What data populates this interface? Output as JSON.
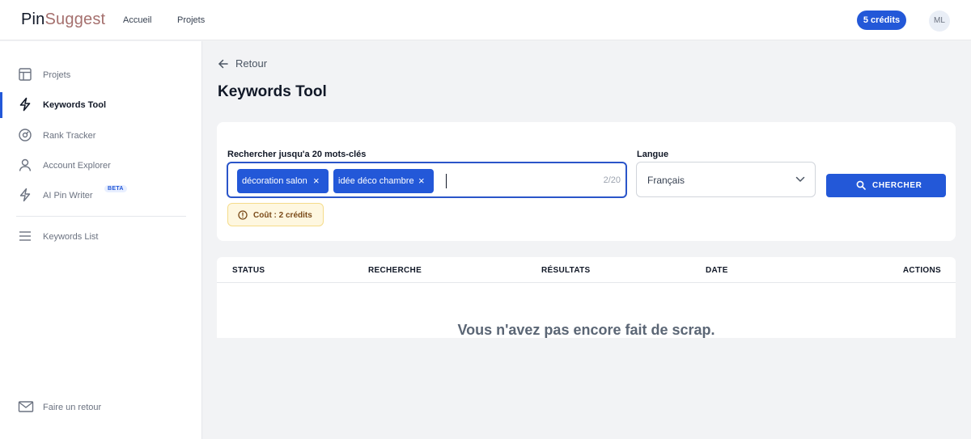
{
  "app": {
    "logo_part1": "Pin",
    "logo_part2": "Suggest"
  },
  "topnav": {
    "items": [
      {
        "label": "Accueil"
      },
      {
        "label": "Projets"
      }
    ],
    "credits_label": "5 crédits",
    "avatar_initials": "ML"
  },
  "sidebar": {
    "items": [
      {
        "label": "Projets",
        "icon": "layout-icon"
      },
      {
        "label": "Keywords Tool",
        "icon": "lightning-icon",
        "active": true
      },
      {
        "label": "Rank Tracker",
        "icon": "gauge-icon"
      },
      {
        "label": "Account Explorer",
        "icon": "user-icon"
      },
      {
        "label": "AI Pin Writer",
        "icon": "lightning-icon",
        "badge": "BETA"
      },
      {
        "label": "Keywords List",
        "icon": "menu-icon"
      }
    ],
    "feedback_label": "Faire un retour"
  },
  "main": {
    "back_label": "Retour",
    "title": "Keywords Tool"
  },
  "search_form": {
    "keywords_label": "Rechercher jusqu'a 20 mots-clés",
    "chips": [
      {
        "label": "décoration salon"
      },
      {
        "label": "idée déco chambre"
      }
    ],
    "input_value": "",
    "counter": "2/20",
    "language_label": "Langue",
    "language_value": "Français",
    "search_button": "CHERCHER",
    "cost_label": "Coût : 2 crédits"
  },
  "results_table": {
    "columns": [
      "STATUS",
      "RECHERCHE",
      "RÉSULTATS",
      "DATE",
      "ACTIONS"
    ],
    "empty_message": "Vous n'avez pas encore fait de scrap."
  },
  "colors": {
    "primary": "#2358d8",
    "logo_accent": "#a5706e",
    "page_background": "#f2f3f5",
    "cost_background": "#fef7e0"
  }
}
